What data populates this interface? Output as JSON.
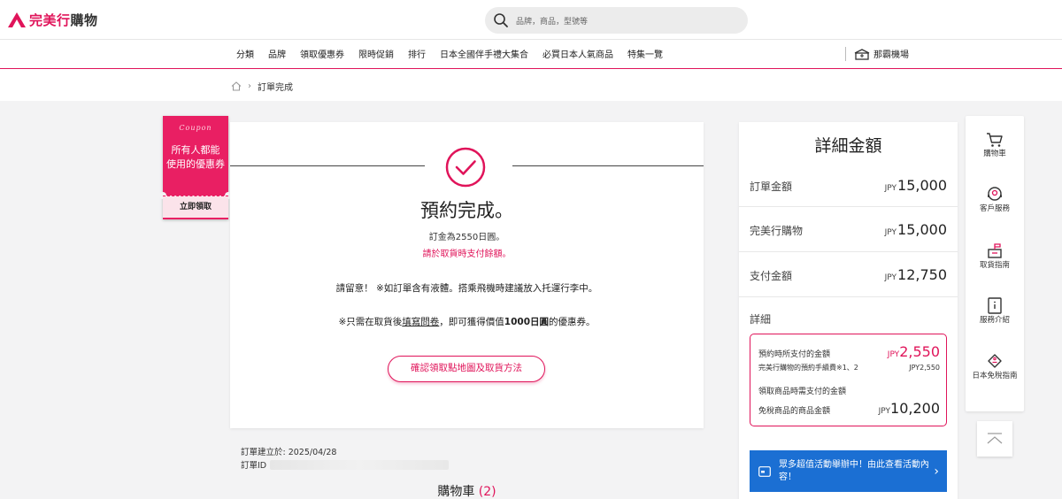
{
  "header": {
    "logo_part1": "完美行",
    "logo_part2": "購物",
    "search_placeholder": "品牌，商品，型號等"
  },
  "nav": {
    "items": [
      "分類",
      "品牌",
      "領取優惠券",
      "限時促銷",
      "排行",
      "日本全國伴手禮大集合",
      "必買日本人氣商品",
      "特集一覽"
    ],
    "airport": "那霸機場"
  },
  "breadcrumb": {
    "current": "訂單完成"
  },
  "coupon": {
    "script_word": "Coupon",
    "line1": "所有人都能",
    "line2": "使用的優惠券",
    "button": "立即領取"
  },
  "confirmation": {
    "title": "預約完成。",
    "deposit_text": "訂金為2550日圓。",
    "pay_note": "請於取貨時支付餘額。",
    "notice": "請留意！ ※如訂單含有液體。搭乘飛機時建議放入托運行李中。",
    "survey_prefix": "※只需在取貨後",
    "survey_link": "填寫問卷",
    "survey_mid": "，即可獲得價值",
    "survey_amount": "1000日圓",
    "survey_suffix": "的優惠券。",
    "pickup_button": "確認領取點地圖及取貨方法"
  },
  "order": {
    "created": "訂單建立於: 2025/04/28",
    "id_label": "訂單ID"
  },
  "cart": {
    "title": "購物車",
    "count": "(2)"
  },
  "summary": {
    "title": "詳細金額",
    "currency": "JPY",
    "rows": [
      {
        "label": "訂單金額",
        "value": "15,000"
      },
      {
        "label": "完美行購物",
        "value": "15,000"
      },
      {
        "label": "支付金額",
        "value": "12,750"
      }
    ],
    "detail_label": "詳細",
    "detail": {
      "reserve_label": "預約時所支付的金額",
      "reserve_value": "2,550",
      "fee_label": "完美行購物的預約手續費※1、2",
      "fee_value": "JPY2,550",
      "pickup_label": "領取商品時需支付的金額",
      "taxfree_label": "免稅商品的商品金額",
      "taxfree_value": "10,200"
    },
    "promo_text": "眾多超值活動舉辦中！由此查看活動內容！"
  },
  "sidebar": {
    "items": [
      "購物車",
      "客戶服務",
      "取貨指南",
      "服務介紹",
      "日本免稅指南"
    ]
  },
  "colors": {
    "brand_pink": "#e0145a",
    "promo_blue": "#1b6fd3"
  }
}
